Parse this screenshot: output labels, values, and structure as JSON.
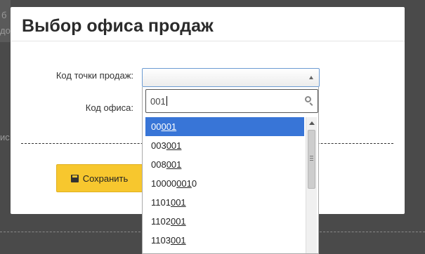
{
  "modal": {
    "title": "Выбор офиса продаж",
    "point_label": "Код точки продаж:",
    "office_label": "Код офиса:",
    "save_label": "Сохранить"
  },
  "dropdown": {
    "search_value": "001",
    "options": [
      {
        "pre": "00",
        "match": "001",
        "post": "",
        "active": true
      },
      {
        "pre": "003",
        "match": "001",
        "post": "",
        "active": false
      },
      {
        "pre": "008",
        "match": "001",
        "post": "",
        "active": false
      },
      {
        "pre": "10000",
        "match": "001",
        "post": "0",
        "active": false
      },
      {
        "pre": "1101",
        "match": "001",
        "post": "",
        "active": false
      },
      {
        "pre": "1102",
        "match": "001",
        "post": "",
        "active": false
      },
      {
        "pre": "1103",
        "match": "001",
        "post": "",
        "active": false
      }
    ]
  },
  "background": {
    "fragments": [
      "б",
      "до",
      "ис"
    ]
  },
  "colors": {
    "accent": "#3875d7",
    "button": "#f7c72e",
    "overlay": "#4a4a4a"
  }
}
